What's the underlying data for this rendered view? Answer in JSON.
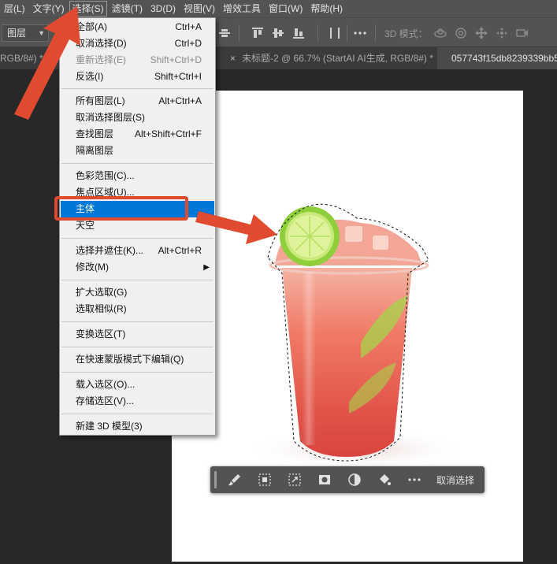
{
  "menubar": {
    "items": [
      {
        "label": "层(L)"
      },
      {
        "label": "文字(Y)"
      },
      {
        "label": "选择(S)"
      },
      {
        "label": "滤镜(T)"
      },
      {
        "label": "3D(D)"
      },
      {
        "label": "视图(V)"
      },
      {
        "label": "增效工具"
      },
      {
        "label": "窗口(W)"
      },
      {
        "label": "帮助(H)"
      }
    ]
  },
  "options": {
    "layer_select": "图层",
    "mode_3d_label": "3D 模式："
  },
  "tabs": [
    {
      "label": "RGB/8#) *"
    },
    {
      "label": "未标题-2 @ 66.7% (StartAI AI生成, RGB/8#) *",
      "close": "×"
    },
    {
      "label": "057743f15db8239339bb5",
      "active": true
    }
  ],
  "select_menu": {
    "groups": [
      [
        {
          "label": "全部(A)",
          "shortcut": "Ctrl+A"
        },
        {
          "label": "取消选择(D)",
          "shortcut": "Ctrl+D"
        },
        {
          "label": "重新选择(E)",
          "shortcut": "Shift+Ctrl+D",
          "disabled": true
        },
        {
          "label": "反选(I)",
          "shortcut": "Shift+Ctrl+I"
        }
      ],
      [
        {
          "label": "所有图层(L)",
          "shortcut": "Alt+Ctrl+A"
        },
        {
          "label": "取消选择图层(S)",
          "shortcut": ""
        },
        {
          "label": "查找图层",
          "shortcut": "Alt+Shift+Ctrl+F"
        },
        {
          "label": "隔离图层",
          "shortcut": ""
        }
      ],
      [
        {
          "label": "色彩范围(C)...",
          "shortcut": ""
        },
        {
          "label": "焦点区域(U)...",
          "shortcut": ""
        },
        {
          "label": "主体",
          "shortcut": "",
          "highlighted": true
        },
        {
          "label": "天空",
          "shortcut": ""
        }
      ],
      [
        {
          "label": "选择并遮住(K)...",
          "shortcut": "Alt+Ctrl+R"
        },
        {
          "label": "修改(M)",
          "shortcut": "",
          "submenu": true
        }
      ],
      [
        {
          "label": "扩大选取(G)",
          "shortcut": ""
        },
        {
          "label": "选取相似(R)",
          "shortcut": ""
        }
      ],
      [
        {
          "label": "变换选区(T)",
          "shortcut": ""
        }
      ],
      [
        {
          "label": "在快速蒙版模式下编辑(Q)",
          "shortcut": ""
        }
      ],
      [
        {
          "label": "载入选区(O)...",
          "shortcut": ""
        },
        {
          "label": "存储选区(V)...",
          "shortcut": ""
        }
      ],
      [
        {
          "label": "新建 3D 模型(3)",
          "shortcut": ""
        }
      ]
    ]
  },
  "taskbar": {
    "deselect_label": "取消选择"
  },
  "colors": {
    "menu_bg": "#535353",
    "workspace_bg": "#282828",
    "highlight": "#0078d7",
    "annotation_red": "#e04a2f"
  }
}
